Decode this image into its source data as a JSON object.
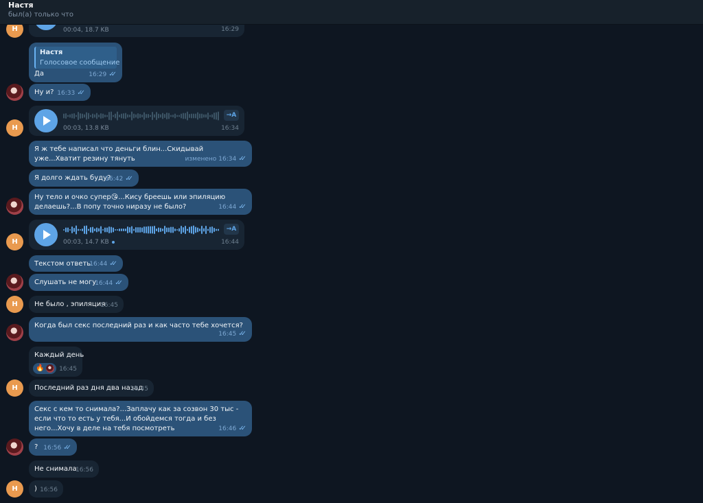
{
  "header": {
    "name": "Настя",
    "status": "был(а) только что"
  },
  "avatars": {
    "contact_initial": "Н"
  },
  "messages": {
    "m1": {
      "info": "00:04, 18.7 KB",
      "time": "16:29"
    },
    "m2": {
      "reply_name": "Настя",
      "reply_text": "Голосовое сообщение",
      "text": "Да",
      "time": "16:29"
    },
    "m3": {
      "text": "Ну и?",
      "time": "16:33"
    },
    "m4": {
      "info": "00:03, 13.8 KB",
      "time": "16:34",
      "transcribe": "→A"
    },
    "m5": {
      "text": "Я ж тебе написал что деньги блин...Скидывай уже...Хватит резину тянуть",
      "edited": "изменено",
      "time": "16:34"
    },
    "m6": {
      "text": "Я долго ждать буду?",
      "time": "16:42"
    },
    "m7": {
      "text_a": "Ну тело и очко супер",
      "emoji": "😘",
      "text_b": "...Кису бреешь или эпиляцию делаешь?...В попу точно ниразу не было?",
      "time": "16:44"
    },
    "m8": {
      "info": "00:03, 14.7 KB",
      "time": "16:44",
      "transcribe": "→A"
    },
    "m9": {
      "text": "Текстом ответь",
      "time": "16:44"
    },
    "m10": {
      "text": "Слушать не могу",
      "time": "16:44"
    },
    "m11": {
      "text": "Не было , эпиляция",
      "time": "16:45"
    },
    "m12": {
      "text": "Когда был секс последний раз и как часто тебе хочется?",
      "time": "16:45"
    },
    "m13": {
      "text": "Каждый день",
      "time": "16:45",
      "reaction": "🔥"
    },
    "m14": {
      "text": "Последний раз дня два назад",
      "time": "16:45"
    },
    "m15": {
      "text": "Секс с кем то снимала?...Заплачу как за созвон 30 тыс - если что то есть у тебя...И обойдемся тогда и без него...Хочу в деле на тебя посмотреть",
      "time": "16:46"
    },
    "m16": {
      "text": "?",
      "time": "16:56"
    },
    "m17": {
      "text": "Не снимала",
      "time": "16:56"
    },
    "m18": {
      "text": ")",
      "time": "16:56"
    }
  },
  "colors": {
    "background": "#0e1621",
    "outgoing_bubble": "#2b5278",
    "incoming_bubble": "#182533",
    "accent": "#5ea4e6",
    "contact_avatar": "#e99a4f"
  },
  "icons": {
    "play": "play-icon",
    "read": "double-check-icon",
    "transcribe": "transcribe-icon"
  }
}
